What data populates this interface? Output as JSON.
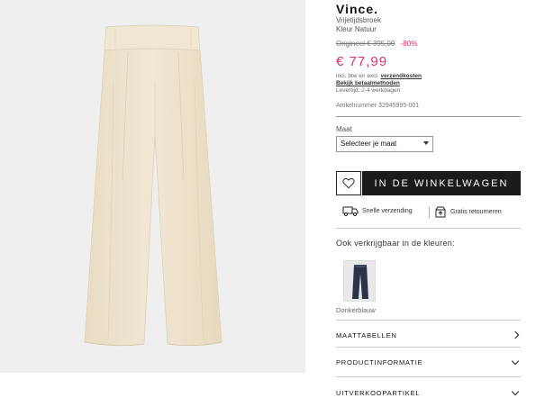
{
  "product": {
    "brand": "Vince.",
    "type": "Vrijetijdsbroek",
    "color_line": "Kleur Natuur",
    "original_price": "Origineel € 395,00",
    "discount": "-80%",
    "price": "€ 77,99",
    "tax_prefix": "incl. btw en excl.",
    "shipping_link": "verzendkosten",
    "payment_link": "Bekijk betaalmethoden",
    "delivery": "Levertijd: 2-4 werkdagen",
    "article_number": "Artikelnummer 32945995-001"
  },
  "size": {
    "label": "Maat",
    "selected": "Selecteer je maat"
  },
  "actions": {
    "wishlist_icon": "heart-icon",
    "add_to_cart": "IN DE WINKELWAGEN"
  },
  "usps": [
    {
      "icon": "truck-icon",
      "label": "Snelle verzending"
    },
    {
      "icon": "return-box-icon",
      "label": "Gratis retourneren"
    }
  ],
  "variants": {
    "heading": "Ook verkrijgbaar in de kleuren:",
    "items": [
      {
        "label": "Donkerblauw"
      }
    ]
  },
  "accordion": [
    {
      "label": "MAATTABELLEN",
      "icon": "chevron-right-icon"
    },
    {
      "label": "PRODUCTINFORMATIE",
      "icon": "chevron-down-icon"
    },
    {
      "label": "UITVERKOOPARTIKEL",
      "icon": "chevron-down-icon"
    }
  ],
  "colors": {
    "sale": "#e0306a",
    "button_bg": "#1b1b1b",
    "image_bg": "#efefef",
    "product_cream": "#efe4cf",
    "variant_navy": "#2a3348"
  }
}
